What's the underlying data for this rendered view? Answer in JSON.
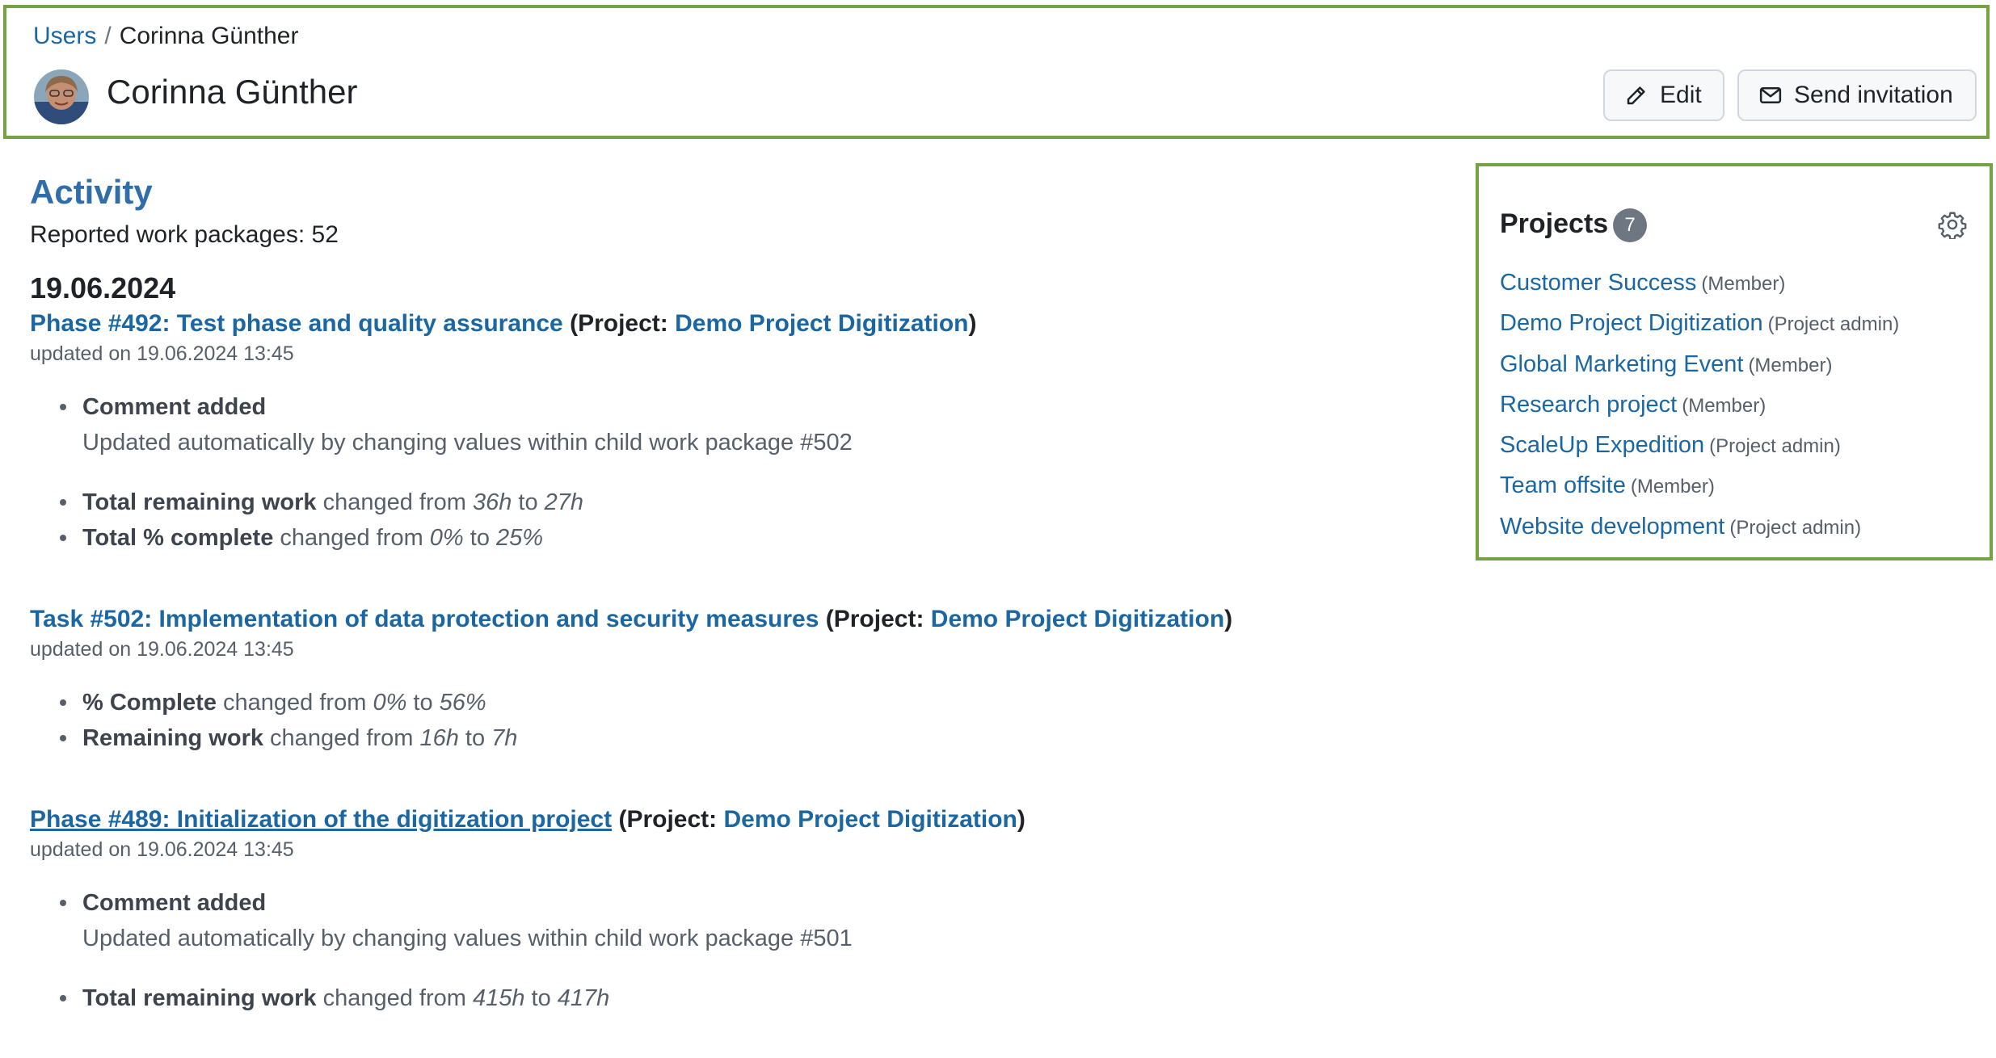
{
  "breadcrumb": {
    "parent": "Users",
    "separator": "/",
    "current": "Corinna Günther"
  },
  "user": {
    "name": "Corinna Günther"
  },
  "buttons": {
    "edit": "Edit",
    "send_invitation": "Send invitation"
  },
  "activity": {
    "title": "Activity",
    "reported": "Reported work packages: 52",
    "date": "19.06.2024",
    "entries": [
      {
        "title": "Phase #492: Test phase and quality assurance",
        "project_prefix": "(Project: ",
        "project": "Demo Project Digitization",
        "project_suffix": ")",
        "updated": "updated on 19.06.2024 13:45",
        "changes": [
          {
            "label": "Comment added",
            "text": "Updated automatically by changing values within child work package #502"
          },
          {
            "label": "Total remaining work",
            "mid": " changed from ",
            "from": "36h",
            "to_word": " to ",
            "to": "27h"
          },
          {
            "label": "Total % complete",
            "mid": " changed from ",
            "from": "0%",
            "to_word": " to ",
            "to": "25%"
          }
        ]
      },
      {
        "title": "Task #502: Implementation of data protection and security measures",
        "project_prefix": "(Project: ",
        "project": "Demo Project Digitization",
        "project_suffix": ")",
        "updated": "updated on 19.06.2024 13:45",
        "changes": [
          {
            "label": "% Complete",
            "mid": " changed from ",
            "from": "0%",
            "to_word": " to ",
            "to": "56%"
          },
          {
            "label": "Remaining work",
            "mid": " changed from ",
            "from": "16h",
            "to_word": " to ",
            "to": "7h"
          }
        ]
      },
      {
        "title": "Phase #489: Initialization of the digitization project",
        "project_prefix": "(Project: ",
        "project": "Demo Project Digitization",
        "project_suffix": ")",
        "updated": "updated on 19.06.2024 13:45",
        "changes": [
          {
            "label": "Comment added",
            "text": "Updated automatically by changing values within child work package #501"
          },
          {
            "label": "Total remaining work",
            "mid": " changed from ",
            "from": "415h",
            "to_word": " to ",
            "to": "417h"
          }
        ]
      }
    ]
  },
  "projects": {
    "title": "Projects",
    "count": "7",
    "items": [
      {
        "name": "Customer Success",
        "role": "(Member)"
      },
      {
        "name": "Demo Project Digitization",
        "role": "(Project admin)"
      },
      {
        "name": "Global Marketing Event",
        "role": "(Member)"
      },
      {
        "name": "Research project",
        "role": "(Member)"
      },
      {
        "name": "ScaleUp Expedition",
        "role": "(Project admin)"
      },
      {
        "name": "Team offsite",
        "role": "(Member)"
      },
      {
        "name": "Website development",
        "role": "(Project admin)"
      }
    ]
  },
  "colors": {
    "accent_border": "#75a343",
    "link": "#1a67a3",
    "heading": "#2f6ea8"
  },
  "icons": {
    "edit": "pencil-icon",
    "invite": "envelope-icon",
    "settings": "gear-icon"
  }
}
